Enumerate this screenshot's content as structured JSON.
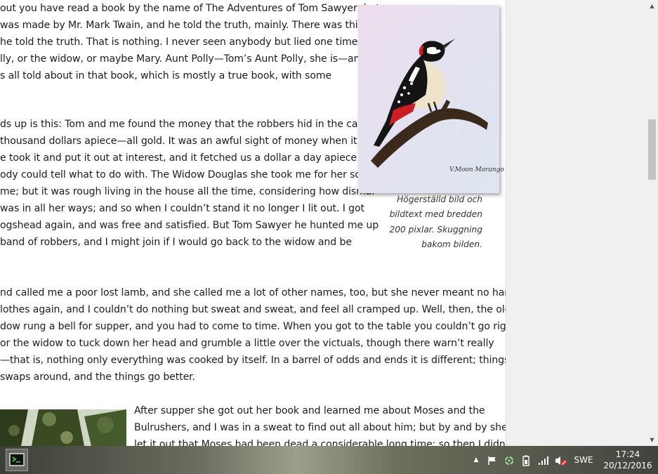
{
  "document": {
    "paragraph1": [
      "out you have read a book by the name of The Adventures of Tom Sawyer; but",
      "was made by Mr. Mark Twain, and he told the truth, mainly. There was things",
      "he told the truth. That is nothing. I never seen anybody but lied one time or",
      "lly, or the widow, or maybe Mary. Aunt Polly—Tom’s Aunt Polly, she is—and",
      "s all told about in that book, which is mostly a true book, with some"
    ],
    "paragraph2": [
      "ds up is this: Tom and me found the money that the robbers hid in the cave,",
      "thousand dollars apiece—all gold. It was an awful sight of money when it was",
      "e took it and put it out at interest, and it fetched us a dollar a day apiece all",
      "ody could tell what to do with. The Widow Douglas she took me for her son,",
      "me; but it was rough living in the house all the time, considering how dismal",
      "was in all her ways; and so when I couldn’t stand it no longer I lit out. I got",
      "ogshead again, and was free and satisfied. But Tom Sawyer he hunted me up",
      " band of robbers, and I might join if I would go back to the widow and be"
    ],
    "paragraph3": [
      "nd called me a poor lost lamb, and she called me a lot of other names, too, but she never meant no harm",
      "lothes again, and I couldn’t do nothing but sweat and sweat, and feel all cramped up. Well, then, the old",
      "dow rung a bell for supper, and you had to come to time. When you got to the table you couldn’t go right",
      "or the widow to tuck down her head and grumble a little over the victuals, though there warn’t really",
      "—that is, nothing only everything was cooked by itself. In a barrel of odds and ends it is different; things get",
      "swaps around, and the things go better."
    ],
    "paragraph4": [
      "After supper she got out her book and learned me about Moses and the",
      "Bulrushers, and I was in a sweat to find out all about him; but by and by she",
      "let it out that Moses had been dead a considerable long time; so then I didn’t"
    ],
    "figure_caption": [
      "Högerställd bild och",
      "bildtext med bredden",
      "200 pixlar. Skuggning",
      "bakom bilden."
    ],
    "signature": "V.Moon Morango"
  },
  "taskbar": {
    "language": "SWE",
    "time": "17:24",
    "date": "20/12/2016"
  },
  "icons": [
    "app-icon",
    "show-hidden-icons-icon",
    "flag-icon",
    "sync-icon",
    "battery-icon",
    "signal-icon",
    "volume-muted-icon",
    "scroll-up-arrow",
    "scroll-down-arrow"
  ]
}
